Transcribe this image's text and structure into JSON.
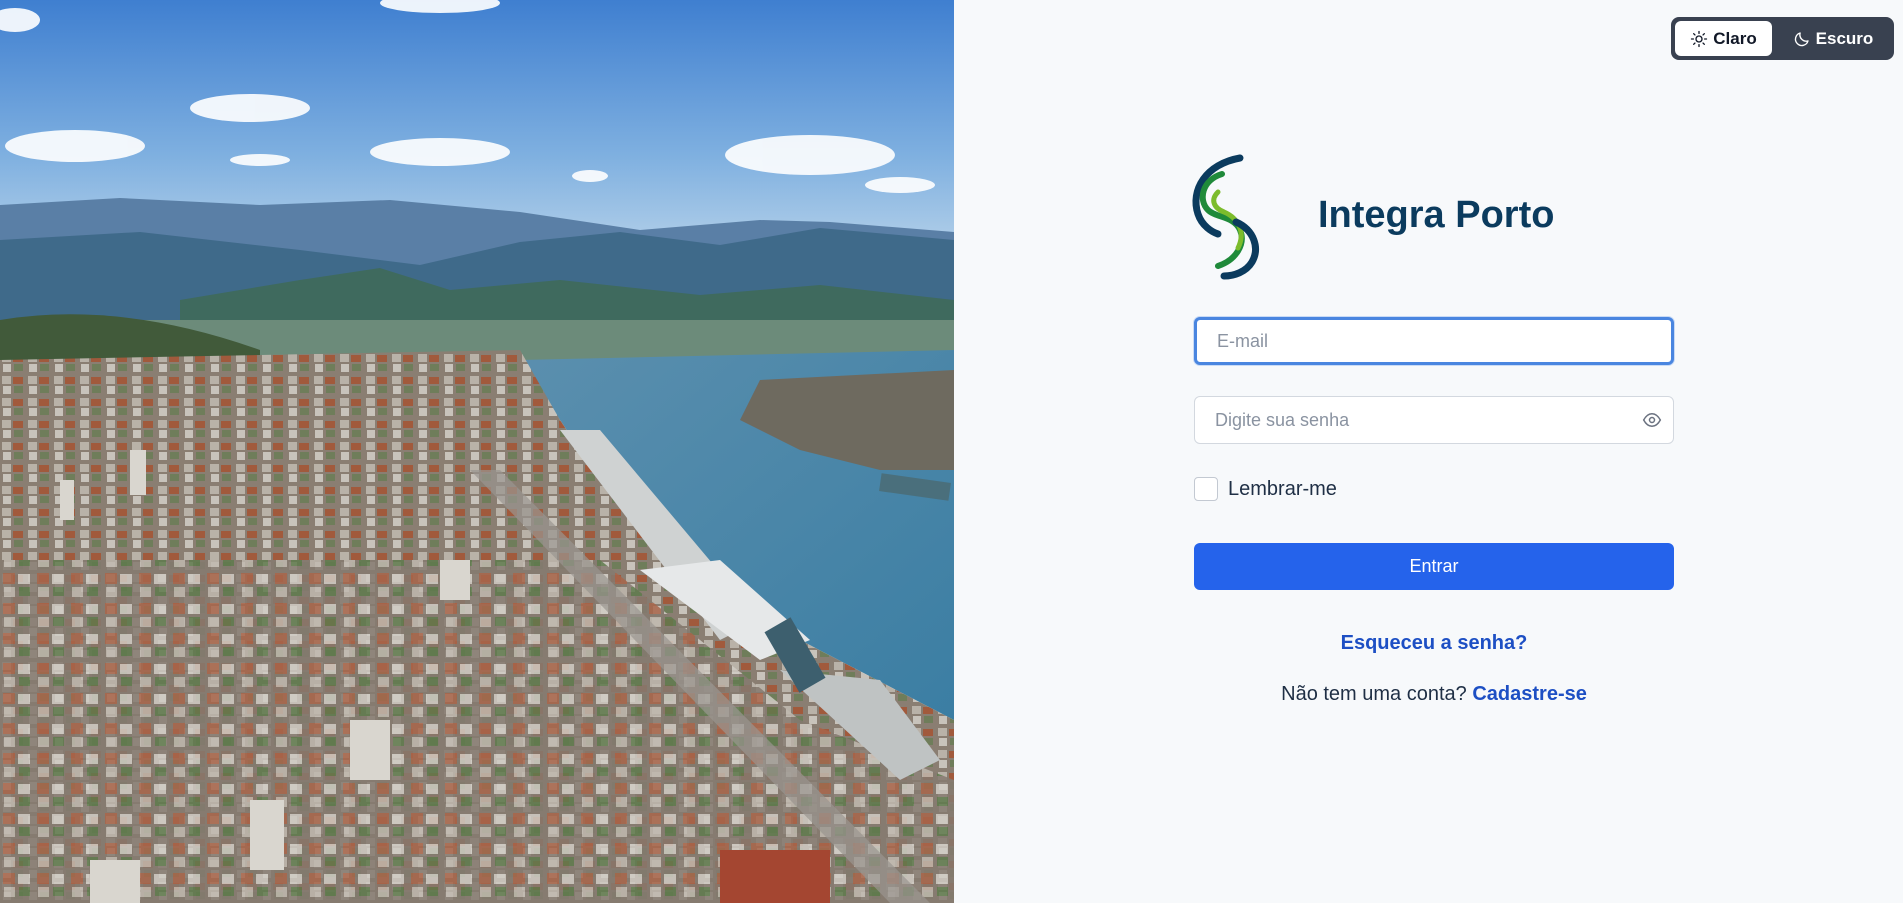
{
  "theme_toggle": {
    "light_label": "Claro",
    "dark_label": "Escuro",
    "active": "light"
  },
  "brand": {
    "title": "Integra Porto"
  },
  "login_form": {
    "email_placeholder": "E-mail",
    "password_placeholder": "Digite sua senha",
    "remember_label": "Lembrar-me",
    "remember_checked": false,
    "submit_label": "Entrar",
    "forgot_label": "Esqueceu a senha?",
    "signup_prompt": "Não tem uma conta?",
    "signup_label": "Cadastre-se"
  },
  "icons": {
    "light": "sun-icon",
    "dark": "moon-icon",
    "password_toggle": "eye-icon"
  },
  "colors": {
    "primary": "#2563eb",
    "link": "#1d4fc4",
    "title": "#0b3b5e",
    "toggle_bg": "#394150",
    "logo_navy": "#0b3b5e",
    "logo_green": "#1f8a3a",
    "logo_lime": "#7cbc2c"
  }
}
